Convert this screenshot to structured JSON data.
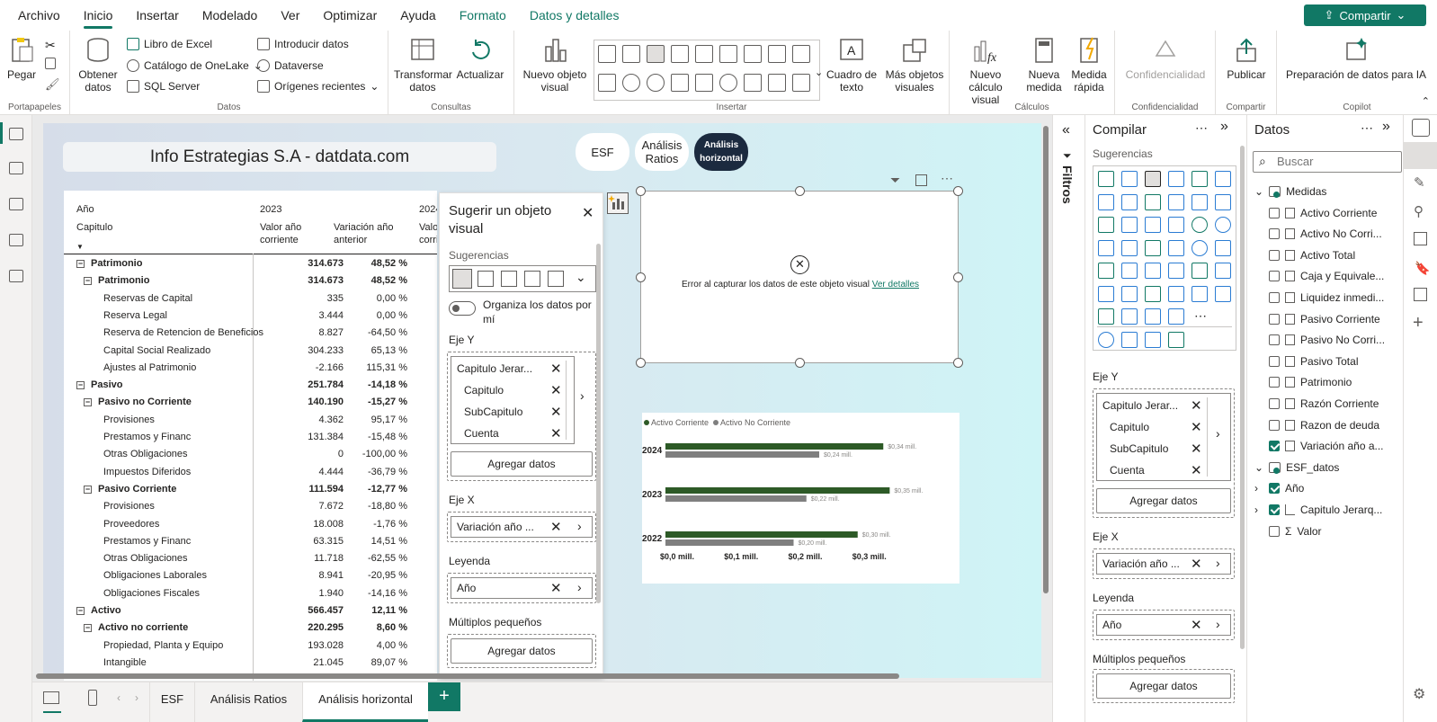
{
  "menu": {
    "items": [
      "Archivo",
      "Inicio",
      "Insertar",
      "Modelado",
      "Ver",
      "Optimizar",
      "Ayuda",
      "Formato",
      "Datos y detalles"
    ],
    "share": "Compartir"
  },
  "ribbon": {
    "pegar": "Pegar",
    "obtener": "Obtener datos",
    "excel": "Libro de Excel",
    "onelake": "Catálogo de OneLake",
    "sql": "SQL Server",
    "introducir": "Introducir datos",
    "dataverse": "Dataverse",
    "recientes": "Orígenes recientes",
    "transformar": "Transformar datos",
    "actualizar": "Actualizar",
    "nuevo_visual": "Nuevo objeto visual",
    "cuadro_texto": "Cuadro de texto",
    "mas_visuales": "Más objetos visuales",
    "nuevo_calculo": "Nuevo cálculo visual",
    "nueva_medida": "Nueva medida",
    "medida_rapida": "Medida rápida",
    "confidencialidad": "Confidencialidad",
    "publicar": "Publicar",
    "preparacion": "Preparación de datos para IA",
    "groups": {
      "portapapeles": "Portapapeles",
      "datos": "Datos",
      "consultas": "Consultas",
      "insertar": "Insertar",
      "calculos": "Cálculos",
      "confidencialidad": "Confidencialidad",
      "compartir": "Compartir",
      "copilot": "Copilot"
    }
  },
  "report": {
    "title": "Info Estrategias S.A - datdata.com",
    "pages": [
      "ESF",
      "Análisis Ratios",
      "Análisis horizontal"
    ]
  },
  "matrix": {
    "h_year": "Año",
    "h_2023": "2023",
    "h_2024": "2024",
    "h_capitulo": "Capitulo",
    "h_valor": "Valor año corriente",
    "h_var": "Variación año anterior",
    "h_valor2": "Valo corri",
    "rows": [
      {
        "label": "Patrimonio",
        "v1": "314.673",
        "v2": "48,52 %",
        "lvl": 0,
        "bold": true,
        "box": "−"
      },
      {
        "label": "Patrimonio",
        "v1": "314.673",
        "v2": "48,52 %",
        "lvl": 1,
        "bold": true,
        "box": "−"
      },
      {
        "label": "Reservas de Capital",
        "v1": "335",
        "v2": "0,00 %",
        "lvl": 2,
        "bold": false,
        "box": ""
      },
      {
        "label": "Reserva Legal",
        "v1": "3.444",
        "v2": "0,00 %",
        "lvl": 2,
        "bold": false,
        "box": ""
      },
      {
        "label": "Reserva de Retencion de Beneficios",
        "v1": "8.827",
        "v2": "-64,50 %",
        "lvl": 2,
        "bold": false,
        "box": ""
      },
      {
        "label": "Capital Social Realizado",
        "v1": "304.233",
        "v2": "65,13 %",
        "lvl": 2,
        "bold": false,
        "box": ""
      },
      {
        "label": "Ajustes al Patrimonio",
        "v1": "-2.166",
        "v2": "115,31 %",
        "lvl": 2,
        "bold": false,
        "box": ""
      },
      {
        "label": "Pasivo",
        "v1": "251.784",
        "v2": "-14,18 %",
        "lvl": 0,
        "bold": true,
        "box": "−"
      },
      {
        "label": "Pasivo no Corriente",
        "v1": "140.190",
        "v2": "-15,27 %",
        "lvl": 1,
        "bold": true,
        "box": "−"
      },
      {
        "label": "Provisiones",
        "v1": "4.362",
        "v2": "95,17 %",
        "lvl": 2,
        "bold": false,
        "box": ""
      },
      {
        "label": "Prestamos y Financ",
        "v1": "131.384",
        "v2": "-15,48 %",
        "lvl": 2,
        "bold": false,
        "box": ""
      },
      {
        "label": "Otras Obligaciones",
        "v1": "0",
        "v2": "-100,00 %",
        "lvl": 2,
        "bold": false,
        "box": ""
      },
      {
        "label": "Impuestos Diferidos",
        "v1": "4.444",
        "v2": "-36,79 %",
        "lvl": 2,
        "bold": false,
        "box": ""
      },
      {
        "label": "Pasivo Corriente",
        "v1": "111.594",
        "v2": "-12,77 %",
        "lvl": 1,
        "bold": true,
        "box": "−"
      },
      {
        "label": "Provisiones",
        "v1": "7.672",
        "v2": "-18,80 %",
        "lvl": 2,
        "bold": false,
        "box": ""
      },
      {
        "label": "Proveedores",
        "v1": "18.008",
        "v2": "-1,76 %",
        "lvl": 2,
        "bold": false,
        "box": ""
      },
      {
        "label": "Prestamos y Financ",
        "v1": "63.315",
        "v2": "14,51 %",
        "lvl": 2,
        "bold": false,
        "box": ""
      },
      {
        "label": "Otras Obligaciones",
        "v1": "11.718",
        "v2": "-62,55 %",
        "lvl": 2,
        "bold": false,
        "box": ""
      },
      {
        "label": "Obligaciones Laborales",
        "v1": "8.941",
        "v2": "-20,95 %",
        "lvl": 2,
        "bold": false,
        "box": ""
      },
      {
        "label": "Obligaciones Fiscales",
        "v1": "1.940",
        "v2": "-14,16 %",
        "lvl": 2,
        "bold": false,
        "box": ""
      },
      {
        "label": "Activo",
        "v1": "566.457",
        "v2": "12,11 %",
        "lvl": 0,
        "bold": true,
        "box": "−"
      },
      {
        "label": "Activo no corriente",
        "v1": "220.295",
        "v2": "8,60 %",
        "lvl": 1,
        "bold": true,
        "box": "−"
      },
      {
        "label": "Propiedad, Planta y Equipo",
        "v1": "193.028",
        "v2": "4,00 %",
        "lvl": 2,
        "bold": false,
        "box": ""
      },
      {
        "label": "Intangible",
        "v1": "21.045",
        "v2": "89,07 %",
        "lvl": 2,
        "bold": false,
        "box": ""
      }
    ]
  },
  "suggest": {
    "title": "Sugerir un objeto visual",
    "sugerencias": "Sugerencias",
    "organiza": "Organiza los datos por mí",
    "eje_y": "Eje Y",
    "y_fields": [
      "Capitulo Jerar...",
      "Capitulo",
      "SubCapitulo",
      "Cuenta"
    ],
    "agregar": "Agregar datos",
    "eje_x": "Eje X",
    "x_field": "Variación año ...",
    "leyenda": "Leyenda",
    "legend_field": "Año",
    "multiples": "Múltiplos pequeños"
  },
  "error_visual": {
    "msg": "Error al capturar los datos de este objeto visual",
    "link": "Ver detalles"
  },
  "chart_data": {
    "type": "bar",
    "orientation": "horizontal",
    "categories": [
      "2024",
      "2023",
      "2022"
    ],
    "series": [
      {
        "name": "Activo Corriente",
        "values": [
          0.34,
          0.35,
          0.3
        ],
        "color": "#2d5a27"
      },
      {
        "name": "Activo No Corriente",
        "values": [
          0.24,
          0.22,
          0.2
        ],
        "color": "#7f7f7f"
      }
    ],
    "data_labels": [
      [
        "$0,34 mill.",
        "$0,24 mill."
      ],
      [
        "$0,35 mill.",
        "$0,22 mill."
      ],
      [
        "$0,30 mill.",
        "$0,20 mill."
      ]
    ],
    "x_ticks": [
      "$0,0 mill.",
      "$0,1 mill.",
      "$0,2 mill.",
      "$0,3 mill."
    ],
    "xlim": [
      0,
      0.4
    ],
    "legend_position": "top-left"
  },
  "filters": {
    "label": "Filtros"
  },
  "build": {
    "title": "Compilar",
    "sugerencias": "Sugerencias",
    "eje_y": "Eje Y",
    "y_fields": [
      "Capitulo Jerar...",
      "Capitulo",
      "SubCapitulo",
      "Cuenta"
    ],
    "agregar": "Agregar datos",
    "eje_x": "Eje X",
    "x_field": "Variación año ...",
    "leyenda": "Leyenda",
    "legend_field": "Año",
    "multiples": "Múltiplos pequeños"
  },
  "datapane": {
    "title": "Datos",
    "search_placeholder": "Buscar",
    "tables": [
      {
        "name": "Medidas",
        "items": [
          {
            "label": "Activo Corriente",
            "checked": false
          },
          {
            "label": "Activo No Corri...",
            "checked": false
          },
          {
            "label": "Activo Total",
            "checked": false
          },
          {
            "label": "Caja y Equivale...",
            "checked": false
          },
          {
            "label": "Liquidez inmedi...",
            "checked": false
          },
          {
            "label": "Pasivo Corriente",
            "checked": false
          },
          {
            "label": "Pasivo No Corri...",
            "checked": false
          },
          {
            "label": "Pasivo Total",
            "checked": false
          },
          {
            "label": "Patrimonio",
            "checked": false
          },
          {
            "label": "Razón Corriente",
            "checked": false
          },
          {
            "label": "Razon de deuda",
            "checked": false
          },
          {
            "label": "Variación año a...",
            "checked": true
          }
        ]
      },
      {
        "name": "ESF_datos",
        "items": [
          {
            "label": "Año",
            "checked": true
          },
          {
            "label": "Capitulo Jerarq...",
            "checked": true
          },
          {
            "label": "Valor",
            "checked": false
          }
        ]
      }
    ]
  },
  "tabs": {
    "items": [
      "ESF",
      "Análisis Ratios",
      "Análisis horizontal"
    ],
    "add": "+"
  }
}
